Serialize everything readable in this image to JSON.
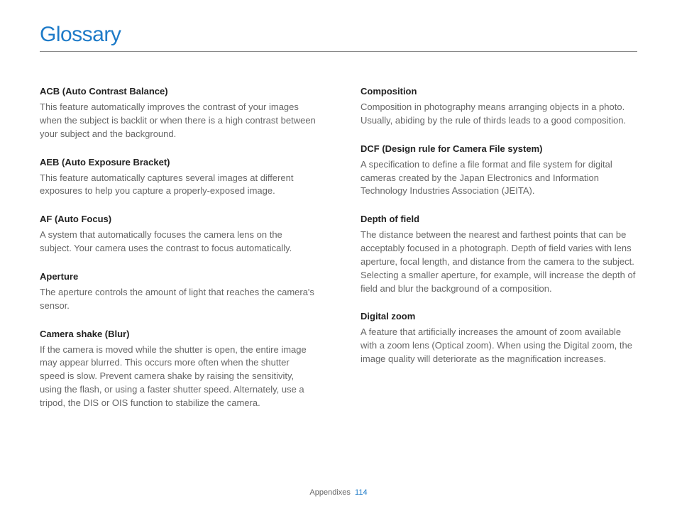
{
  "title": "Glossary",
  "footer": {
    "section": "Appendixes",
    "page": "114"
  },
  "left": [
    {
      "term": "ACB (Auto Contrast Balance)",
      "def": "This feature automatically improves the contrast of your images when the subject is backlit or when there is a high contrast between your subject and the background."
    },
    {
      "term": "AEB (Auto Exposure Bracket)",
      "def": "This feature automatically captures several images at different exposures to help you capture a properly-exposed image."
    },
    {
      "term": "AF (Auto Focus)",
      "def": "A system that automatically focuses the camera lens on the subject. Your camera uses the contrast to focus automatically."
    },
    {
      "term": "Aperture",
      "def": "The aperture controls the amount of light that reaches the camera's sensor."
    },
    {
      "term": "Camera shake (Blur)",
      "def": "If the camera is moved while the shutter is open, the entire image may appear blurred. This occurs more often when the shutter speed is slow. Prevent camera shake by raising the sensitivity, using the flash, or using a faster shutter speed. Alternately, use a tripod, the DIS or OIS function to stabilize the camera."
    }
  ],
  "right": [
    {
      "term": "Composition",
      "def": "Composition in photography means arranging objects in a photo. Usually, abiding by the rule of thirds leads to a good composition."
    },
    {
      "term": "DCF (Design rule for Camera File system)",
      "def": "A specification to define a file format and file system for digital cameras created by the Japan Electronics and Information Technology Industries Association (JEITA)."
    },
    {
      "term": "Depth of field",
      "def": "The distance between the nearest and farthest points that can be acceptably focused in a photograph. Depth of field varies with lens aperture, focal length, and distance from the camera to the subject. Selecting a smaller aperture, for example, will increase the depth of field and blur the background of a composition."
    },
    {
      "term": "Digital zoom",
      "def": "A feature that artificially increases the amount of zoom available with a zoom lens (Optical zoom). When using the Digital zoom, the image quality will deteriorate as the magnification increases."
    }
  ]
}
